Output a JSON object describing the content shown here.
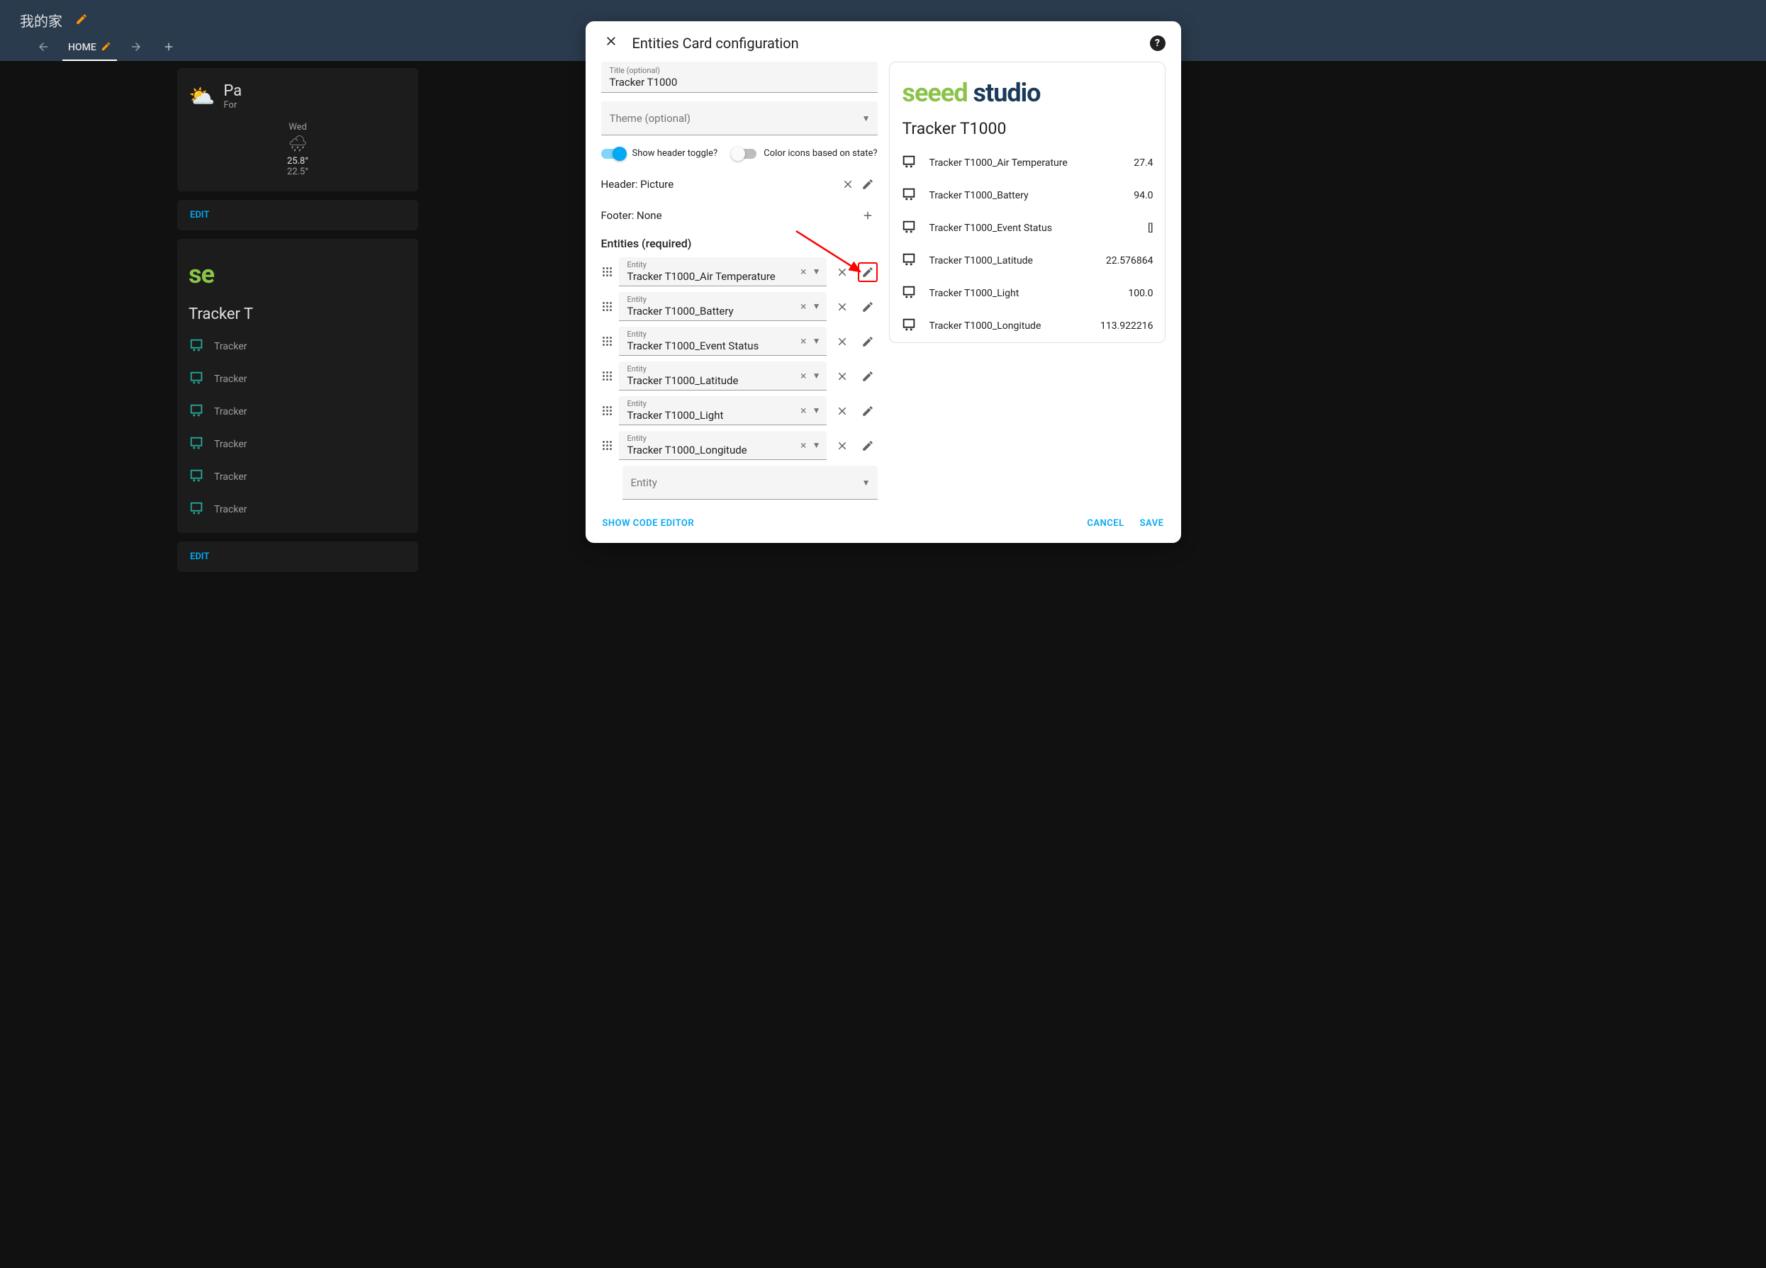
{
  "topbar": {
    "title": "我的家",
    "tab_home": "HOME"
  },
  "weather": {
    "title_short": "Pa",
    "sub_short": "For",
    "day": "Wed",
    "high": "25.8°",
    "low": "22.5°"
  },
  "bg": {
    "edit": "EDIT",
    "card_title": "Tracker T",
    "rows": [
      "Tracker",
      "Tracker",
      "Tracker",
      "Tracker",
      "Tracker",
      "Tracker"
    ]
  },
  "modal": {
    "title": "Entities Card configuration",
    "title_field_label": "Title (optional)",
    "title_field_value": "Tracker T1000",
    "theme_field_label": "Theme (optional)",
    "toggle_header_label": "Show header toggle?",
    "toggle_color_label": "Color icons based on state?",
    "header_label": "Header: Picture",
    "footer_label": "Footer: None",
    "entities_section": "Entities (required)",
    "entity_field_label": "Entity",
    "entities": [
      "Tracker T1000_Air Temperature",
      "Tracker T1000_Battery",
      "Tracker T1000_Event Status",
      "Tracker T1000_Latitude",
      "Tracker T1000_Light",
      "Tracker T1000_Longitude"
    ],
    "new_entity_placeholder": "Entity",
    "show_code": "SHOW CODE EDITOR",
    "cancel": "CANCEL",
    "save": "SAVE"
  },
  "preview": {
    "logo_seed": "seeed",
    "logo_studio": "studio",
    "title": "Tracker T1000",
    "rows": [
      {
        "name": "Tracker T1000_Air Temperature",
        "value": "27.4"
      },
      {
        "name": "Tracker T1000_Battery",
        "value": "94.0"
      },
      {
        "name": "Tracker T1000_Event Status",
        "value": "[]"
      },
      {
        "name": "Tracker T1000_Latitude",
        "value": "22.576864"
      },
      {
        "name": "Tracker T1000_Light",
        "value": "100.0"
      },
      {
        "name": "Tracker T1000_Longitude",
        "value": "113.922216"
      }
    ]
  }
}
